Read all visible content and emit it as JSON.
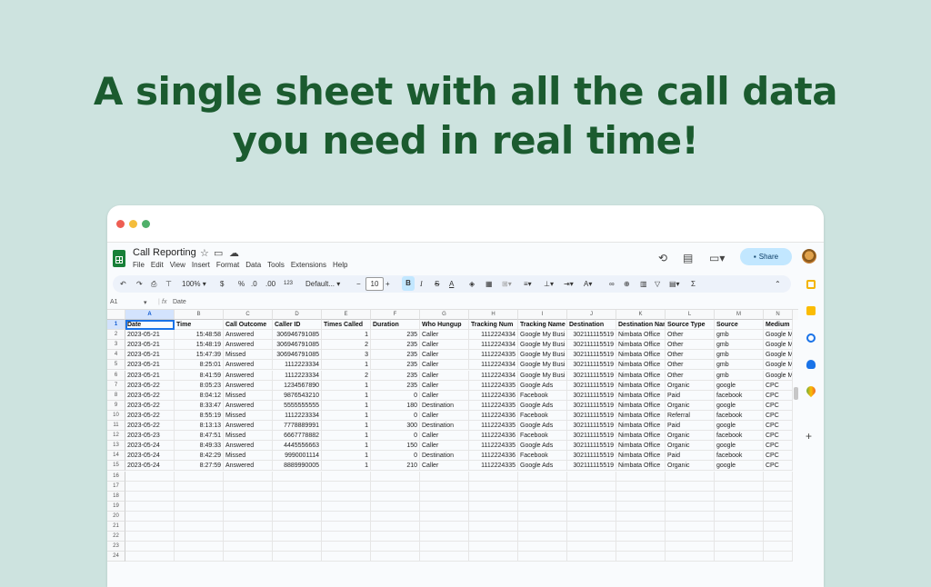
{
  "headline": {
    "line1": "A single sheet with all the call data",
    "line2": "you need in real time!"
  },
  "window": {
    "dots": [
      "#ee5e53",
      "#f4bd3c",
      "#4fb06a"
    ]
  },
  "doc": {
    "title": "Call Reporting"
  },
  "menu": [
    "File",
    "Edit",
    "View",
    "Insert",
    "Format",
    "Data",
    "Tools",
    "Extensions",
    "Help"
  ],
  "share_label": "Share",
  "toolbar": {
    "zoom": "100%",
    "font": "Default...",
    "font_size": "10",
    "currency": "$",
    "percent": "%",
    "dec_less": ".0",
    "dec_more": ".00",
    "number_format": "123",
    "bold": "B",
    "italic": "I",
    "strike": "S",
    "text_color": "A",
    "sum": "Σ"
  },
  "formula": {
    "name_box": "A1",
    "fx": "fx",
    "value": "Date"
  },
  "columns": [
    "A",
    "B",
    "C",
    "D",
    "E",
    "F",
    "G",
    "H",
    "I",
    "J",
    "K",
    "L",
    "M",
    "N"
  ],
  "header_row": [
    "Date",
    "Time",
    "Call Outcome",
    "Caller ID",
    "Times Called",
    "Duration",
    "Who Hungup",
    "Tracking Num",
    "Tracking Name",
    "Destination",
    "Destination Nar",
    "Source Type",
    "Source",
    "Medium"
  ],
  "rows": [
    [
      "2023-05-21",
      "15:48:58",
      "Answered",
      "306946791085",
      "1",
      "235",
      "Caller",
      "1112224334",
      "Google My Busi",
      "302111115519",
      "Nimbata Office",
      "Other",
      "gmb",
      "Google M"
    ],
    [
      "2023-05-21",
      "15:48:19",
      "Answered",
      "306946791085",
      "2",
      "235",
      "Caller",
      "1112224334",
      "Google My Busi",
      "302111115519",
      "Nimbata Office",
      "Other",
      "gmb",
      "Google M"
    ],
    [
      "2023-05-21",
      "15:47:39",
      "Missed",
      "306946791085",
      "3",
      "235",
      "Caller",
      "1112224335",
      "Google My Busi",
      "302111115519",
      "Nimbata Office",
      "Other",
      "gmb",
      "Google M"
    ],
    [
      "2023-05-21",
      "8:25:01",
      "Answered",
      "1112223334",
      "1",
      "235",
      "Caller",
      "1112224334",
      "Google My Busi",
      "302111115519",
      "Nimbata Office",
      "Other",
      "gmb",
      "Google M"
    ],
    [
      "2023-05-21",
      "8:41:59",
      "Answered",
      "1112223334",
      "2",
      "235",
      "Caller",
      "1112224334",
      "Google My Busi",
      "302111115519",
      "Nimbata Office",
      "Other",
      "gmb",
      "Google M"
    ],
    [
      "2023-05-22",
      "8:05:23",
      "Answered",
      "1234567890",
      "1",
      "235",
      "Caller",
      "1112224335",
      "Google Ads",
      "302111115519",
      "Nimbata Office",
      "Organic",
      "google",
      "CPC"
    ],
    [
      "2023-05-22",
      "8:04:12",
      "Missed",
      "9876543210",
      "1",
      "0",
      "Caller",
      "1112224336",
      "Facebook",
      "302111115519",
      "Nimbata Office",
      "Paid",
      "facebook",
      "CPC"
    ],
    [
      "2023-05-22",
      "8:33:47",
      "Answered",
      "5555555555",
      "1",
      "180",
      "Destination",
      "1112224335",
      "Google Ads",
      "302111115519",
      "Nimbata Office",
      "Organic",
      "google",
      "CPC"
    ],
    [
      "2023-05-22",
      "8:55:19",
      "Missed",
      "1112223334",
      "1",
      "0",
      "Caller",
      "1112224336",
      "Facebook",
      "302111115519",
      "Nimbata Office",
      "Referral",
      "facebook",
      "CPC"
    ],
    [
      "2023-05-22",
      "8:13:13",
      "Answered",
      "7778889991",
      "1",
      "300",
      "Destination",
      "1112224335",
      "Google Ads",
      "302111115519",
      "Nimbata Office",
      "Paid",
      "google",
      "CPC"
    ],
    [
      "2023-05-23",
      "8:47:51",
      "Missed",
      "6667778882",
      "1",
      "0",
      "Caller",
      "1112224336",
      "Facebook",
      "302111115519",
      "Nimbata Office",
      "Organic",
      "facebook",
      "CPC"
    ],
    [
      "2023-05-24",
      "8:49:33",
      "Answered",
      "4445556663",
      "1",
      "150",
      "Caller",
      "1112224335",
      "Google Ads",
      "302111115519",
      "Nimbata Office",
      "Organic",
      "google",
      "CPC"
    ],
    [
      "2023-05-24",
      "8:42:29",
      "Missed",
      "9990001114",
      "1",
      "0",
      "Destination",
      "1112224336",
      "Facebook",
      "302111115519",
      "Nimbata Office",
      "Paid",
      "facebook",
      "CPC"
    ],
    [
      "2023-05-24",
      "8:27:59",
      "Answered",
      "8889990005",
      "1",
      "210",
      "Caller",
      "1112224335",
      "Google Ads",
      "302111115519",
      "Nimbata Office",
      "Organic",
      "google",
      "CPC"
    ]
  ],
  "row_numbers": [
    "1",
    "2",
    "3",
    "4",
    "5",
    "6",
    "7",
    "8",
    "9",
    "10",
    "11",
    "12",
    "13",
    "14",
    "15",
    "16",
    "17",
    "18",
    "19",
    "20",
    "21",
    "22",
    "23",
    "24"
  ]
}
